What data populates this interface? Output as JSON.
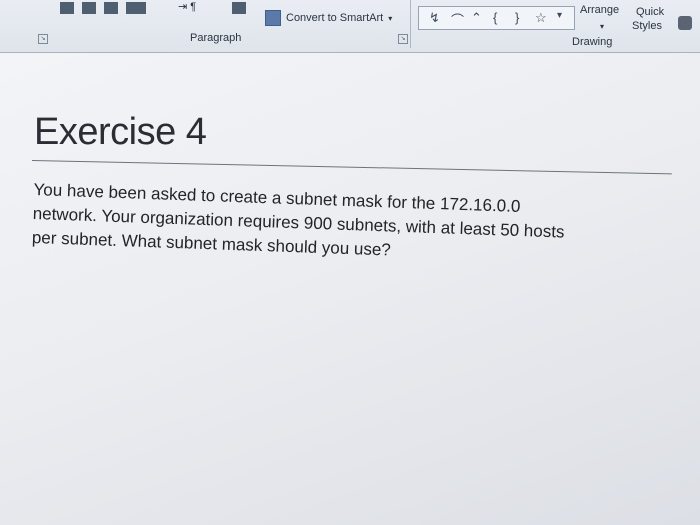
{
  "ribbon": {
    "smartart_label": "Convert to SmartArt",
    "paragraph_group": "Paragraph",
    "drawing_group": "Drawing",
    "arrange_label": "Arrange",
    "quick_styles_label_1": "Quick",
    "quick_styles_label_2": "Styles"
  },
  "slide": {
    "title": "Exercise 4",
    "body_lines": [
      "You have been asked to create a subnet mask for the 172.16.0.0",
      "network. Your organization requires 900 subnets, with at least 50 hosts",
      "per subnet. What subnet mask should you use?"
    ]
  },
  "colors": {
    "ribbon_bg": "#e4e8ee",
    "slide_bg": "#eceef2",
    "text": "#222429"
  }
}
